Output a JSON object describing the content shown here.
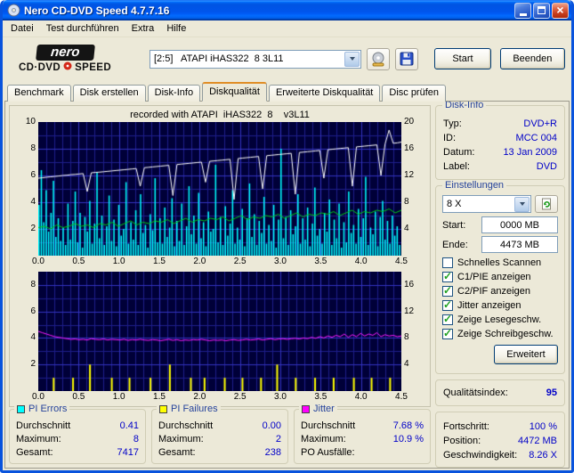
{
  "window": {
    "title": "Nero CD-DVD Speed 4.7.7.16"
  },
  "menu": {
    "items": [
      "Datei",
      "Test durchführen",
      "Extra",
      "Hilfe"
    ]
  },
  "toolbar": {
    "logo": {
      "line1": "nero",
      "line2a": "CD·DVD",
      "line2b": "SPEED"
    },
    "drive_select": "[2:5]   ATAPI iHAS322  8 3L11",
    "start_label": "Start",
    "quit_label": "Beenden"
  },
  "tabs": {
    "active_index": 3,
    "items": [
      "Benchmark",
      "Disk erstellen",
      "Disk-Info",
      "Diskqualität",
      "Erweiterte Diskqualität",
      "Disc prüfen"
    ]
  },
  "main": {
    "recorded_note": "recorded with ATAPI  iHAS322  8    v3L11"
  },
  "disk_info": {
    "title": "Disk-Info",
    "rows": [
      {
        "label": "Typ:",
        "value": "DVD+R"
      },
      {
        "label": "ID:",
        "value": "MCC 004"
      },
      {
        "label": "Datum:",
        "value": "13 Jan 2009"
      },
      {
        "label": "Label:",
        "value": "DVD"
      }
    ]
  },
  "settings": {
    "title": "Einstellungen",
    "speed_value": "8 X",
    "fields": [
      {
        "label": "Start:",
        "value": "0000 MB"
      },
      {
        "label": "Ende:",
        "value": "4473 MB"
      }
    ],
    "checkboxes": [
      {
        "label": "Schnelles Scannen",
        "checked": false
      },
      {
        "label": "C1/PIE anzeigen",
        "checked": true
      },
      {
        "label": "C2/PIF anzeigen",
        "checked": true
      },
      {
        "label": "Jitter anzeigen",
        "checked": true
      },
      {
        "label": "Zeige Lesegeschw.",
        "checked": true
      },
      {
        "label": "Zeige Schreibgeschw.",
        "checked": true
      }
    ],
    "advanced_label": "Erweitert"
  },
  "quality_index": {
    "label": "Qualitätsindex:",
    "value": "95"
  },
  "progress": {
    "rows": [
      {
        "label": "Fortschritt:",
        "value": "100 %"
      },
      {
        "label": "Position:",
        "value": "4472 MB"
      },
      {
        "label": "Geschwindigkeit:",
        "value": "8.26 X"
      }
    ]
  },
  "stats": [
    {
      "title": "PI Errors",
      "color": "#00FFFF",
      "rows": [
        {
          "label": "Durchschnitt",
          "value": "0.41"
        },
        {
          "label": "Maximum:",
          "value": "8"
        },
        {
          "label": "Gesamt:",
          "value": "7417"
        }
      ]
    },
    {
      "title": "PI Failures",
      "color": "#FFFF00",
      "rows": [
        {
          "label": "Durchschnitt",
          "value": "0.00"
        },
        {
          "label": "Maximum:",
          "value": "2"
        },
        {
          "label": "Gesamt:",
          "value": "238"
        }
      ]
    },
    {
      "title": "Jitter",
      "color": "#FF00FF",
      "rows": [
        {
          "label": "Durchschnitt",
          "value": "7.68 %"
        },
        {
          "label": "Maximum:",
          "value": "10.9 %"
        },
        {
          "label": "PO Ausfälle:",
          "value": ""
        }
      ]
    }
  ],
  "chart_data": [
    {
      "type": "bar",
      "name": "pi-errors-and-speed",
      "bg": "#000038",
      "grid": "#1D1D8A",
      "grid_major": "#3232C0",
      "x_range": [
        0,
        4.5
      ],
      "x_ticks": [
        "0.0",
        "0.5",
        "1.0",
        "1.5",
        "2.0",
        "2.5",
        "3.0",
        "3.5",
        "4.0",
        "4.5"
      ],
      "y_left": {
        "max": 10,
        "ticks": [
          2,
          4,
          6,
          8,
          10
        ]
      },
      "y_right": {
        "max": 20,
        "ticks": [
          4,
          8,
          12,
          16,
          20
        ]
      },
      "series": [
        {
          "name": "PI Errors",
          "kind": "bar",
          "color": "#00FFFF",
          "axis": "left",
          "values": [
            3.8,
            6.4,
            2.5,
            4.9,
            1.8,
            3.2,
            5.6,
            1.4,
            2.8,
            1.1,
            2.1,
            0.8,
            3.9,
            1.2,
            2.6,
            4.8,
            1.0,
            3.2,
            0.6,
            2.9,
            1.8,
            4.1,
            0.9,
            2.4,
            6.2,
            1.3,
            3.0,
            0.8,
            2.2,
            4.5,
            1.1,
            2.7,
            0.7,
            3.8,
            1.5,
            2.0,
            5.5,
            0.9,
            2.5,
            1.2,
            3.4,
            0.8,
            4.6,
            1.7,
            2.3,
            0.6,
            3.1,
            1.9,
            5.8,
            1.0,
            2.8,
            0.9,
            3.6,
            1.4,
            2.1,
            4.3,
            0.7,
            2.6,
            1.1,
            3.9,
            0.8,
            2.2,
            5.2,
            1.6,
            3.0,
            0.9,
            4.7,
            1.3,
            2.5,
            0.7,
            3.3,
            1.8,
            2.0,
            6.8,
            1.0,
            2.9,
            0.8,
            3.7,
            1.5,
            2.4,
            4.9,
            0.9,
            2.1,
            1.2,
            3.5,
            0.7,
            2.8,
            5.4,
            1.4,
            3.1,
            0.8,
            2.6,
            1.7,
            4.4,
            0.9,
            2.3,
            1.1,
            3.8,
            0.6,
            2.7,
            8.0,
            1.3,
            2.9,
            0.8,
            3.4,
            1.6,
            2.2,
            4.6,
            0.9,
            2.8,
            1.2,
            3.6,
            0.7,
            2.4,
            5.1,
            1.5,
            2.0,
            0.9,
            3.2,
            1.8,
            4.2,
            0.8,
            2.7,
            1.3,
            3.9,
            0.6,
            2.5,
            1.0,
            4.8,
            1.7,
            2.3,
            0.9,
            3.5,
            1.4,
            2.8,
            5.9,
            0.8,
            2.1,
            1.6,
            3.3,
            0.7,
            2.9,
            4.1,
            1.2,
            2.6,
            0.9,
            3.0,
            1.5,
            2.2,
            0.8
          ]
        },
        {
          "name": "Lesegeschwindigkeit",
          "kind": "line",
          "color": "#00C814",
          "axis": "left",
          "values": [
            2.1,
            2.2,
            2.0,
            2.3,
            2.1,
            2.2,
            2.4,
            2.2,
            2.3,
            2.1,
            2.4,
            2.3,
            2.5,
            2.2,
            2.4,
            2.6,
            2.3,
            2.5,
            2.4,
            2.6,
            2.5,
            2.7,
            2.4,
            2.6,
            2.8,
            2.5,
            2.7,
            2.6,
            2.8,
            2.7,
            2.9,
            2.6,
            2.8,
            3.0,
            2.7,
            2.9,
            2.8,
            3.0,
            2.9,
            3.1,
            2.8,
            3.0,
            3.2,
            2.9,
            3.1,
            3.0,
            3.2,
            3.1,
            3.3,
            3.0,
            3.2,
            3.4,
            3.1,
            3.3,
            3.2,
            3.4,
            3.3,
            3.5,
            3.2,
            3.4
          ]
        },
        {
          "name": "Schreibgeschwindigkeit",
          "kind": "line",
          "color": "#FFFFFF",
          "axis": "left",
          "values": [
            5.8,
            5.83,
            5.87,
            5.9,
            5.93,
            5.96,
            6.0,
            6.02,
            6.06,
            6.08,
            6.11,
            6.14,
            4.8,
            6.2,
            6.23,
            6.25,
            6.28,
            6.31,
            6.34,
            6.37,
            6.4,
            6.43,
            6.46,
            6.49,
            6.52,
            5.2,
            6.58,
            6.61,
            6.64,
            6.67,
            6.7,
            6.73,
            6.76,
            4.5,
            6.82,
            6.85,
            6.88,
            6.91,
            6.94,
            6.97,
            7.0,
            5.5,
            7.06,
            7.09,
            7.12,
            7.15,
            7.18,
            7.21,
            4.2,
            7.27,
            7.3,
            7.33,
            7.36,
            7.39,
            7.42,
            5.0,
            7.48,
            7.51,
            7.54,
            7.57,
            7.6,
            7.63,
            7.66,
            4.6,
            7.72,
            7.75,
            7.78,
            7.81,
            7.84,
            7.87,
            5.8,
            7.93,
            7.96,
            7.99,
            8.02,
            8.05,
            8.08,
            5.2,
            8.14,
            8.17,
            8.2,
            8.23,
            8.26,
            8.29,
            6.0,
            8.35,
            9.4,
            8.41,
            8.44,
            8.5
          ]
        }
      ]
    },
    {
      "type": "line",
      "name": "jitter-and-pi-failures",
      "bg": "#000038",
      "grid": "#1D1D8A",
      "grid_major": "#3232C0",
      "x_range": [
        0,
        4.5
      ],
      "x_ticks": [
        "0.0",
        "0.5",
        "1.0",
        "1.5",
        "2.0",
        "2.5",
        "3.0",
        "3.5",
        "4.0",
        "4.5"
      ],
      "y_left": {
        "max": 9,
        "ticks": [
          2,
          4,
          6,
          8
        ]
      },
      "y_right": {
        "max": 18,
        "ticks": [
          4,
          8,
          12,
          16
        ]
      },
      "series": [
        {
          "name": "PI Failures",
          "kind": "points-bar",
          "color": "#FFFF00",
          "axis": "left",
          "points": [
            [
              0.18,
              1
            ],
            [
              0.42,
              1
            ],
            [
              0.63,
              2
            ],
            [
              0.9,
              1
            ],
            [
              1.12,
              1
            ],
            [
              1.38,
              1
            ],
            [
              1.62,
              2
            ],
            [
              1.88,
              1
            ],
            [
              2.05,
              1
            ],
            [
              2.3,
              1
            ],
            [
              2.52,
              1
            ],
            [
              2.75,
              1
            ],
            [
              2.95,
              2
            ],
            [
              3.18,
              1
            ],
            [
              3.42,
              1
            ],
            [
              3.65,
              1
            ],
            [
              3.9,
              1
            ],
            [
              4.12,
              1
            ],
            [
              4.35,
              1
            ]
          ]
        },
        {
          "name": "Jitter",
          "kind": "line",
          "color": "#FF1AFF",
          "axis": "right",
          "values": [
            9.0,
            8.8,
            8.6,
            8.4,
            8.2,
            8.1,
            8.0,
            7.9,
            7.8,
            7.85,
            7.75,
            7.8,
            7.7,
            7.9,
            7.8,
            7.75,
            7.85,
            7.7,
            7.8,
            7.75,
            7.7,
            7.8,
            7.65,
            7.75,
            7.7,
            7.8,
            7.7,
            7.65,
            7.75,
            7.7,
            7.6,
            7.7,
            7.8,
            7.65,
            7.75,
            7.6,
            7.7,
            7.65,
            7.75,
            7.7,
            7.8,
            7.7,
            7.6,
            7.7,
            7.65,
            7.7,
            7.6,
            7.7,
            7.75,
            7.65,
            7.7,
            7.8,
            7.7,
            7.75,
            7.85,
            7.7,
            7.8,
            7.9,
            7.75,
            7.85,
            7.9,
            7.8,
            7.9,
            7.95,
            7.85,
            8.0,
            7.9,
            8.1,
            7.95,
            8.2,
            8.0,
            8.3,
            8.1,
            8.4,
            8.2,
            8.6,
            8.1,
            8.5,
            8.2,
            8.7,
            8.3,
            8.6,
            8.4,
            8.8,
            8.2,
            8.5,
            8.3,
            8.4,
            8.2,
            8.3
          ]
        }
      ]
    }
  ]
}
